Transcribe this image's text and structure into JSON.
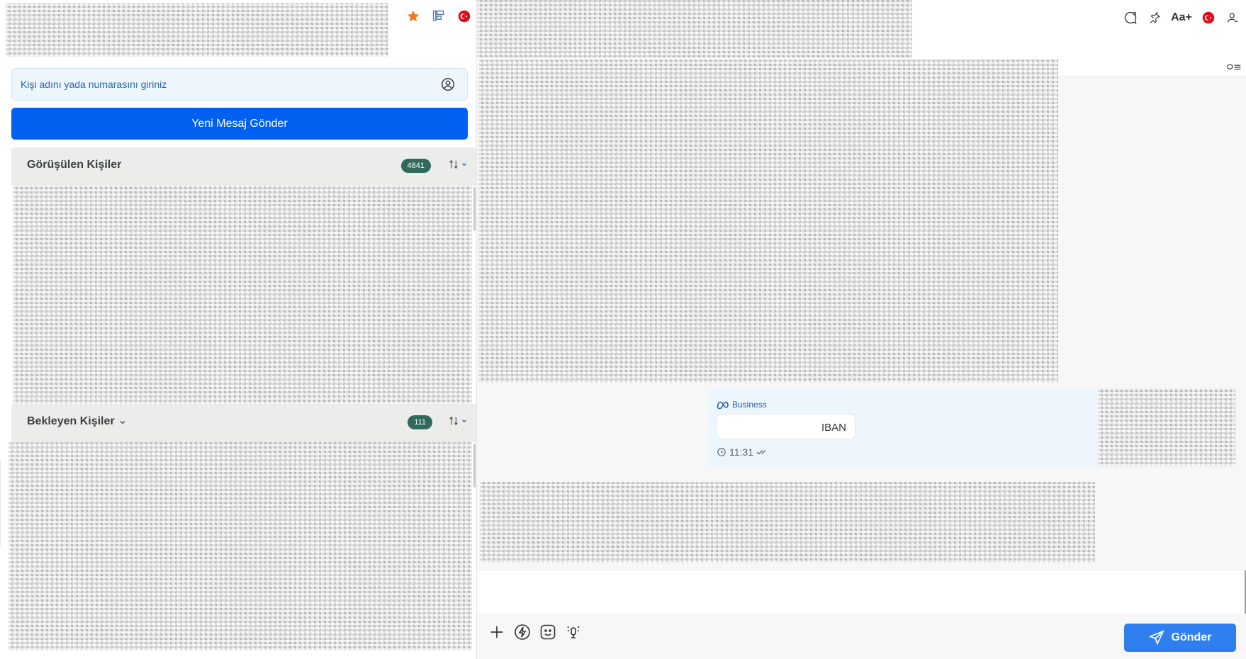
{
  "left_panel": {
    "search": {
      "placeholder": "Kişi adını yada numarasını giriniz"
    },
    "new_message_button": "Yeni Mesaj Gönder",
    "sections": [
      {
        "title": "Görüşülen Kişiler",
        "count": "4841"
      },
      {
        "title": "Bekleyen Kişiler",
        "count": "111"
      }
    ],
    "top_icons": [
      "star-icon",
      "pin-list-icon",
      "turkey-flag-icon"
    ]
  },
  "right_panel": {
    "header_icons": [
      "chat-bubble-icon",
      "pin-icon",
      "font-size-icon",
      "turkey-flag-icon",
      "user-icon"
    ],
    "font_size_label": "Aa+",
    "message": {
      "brand": "Business",
      "text": "IBAN",
      "time": "11:31",
      "status": "read"
    },
    "composer": {
      "tools": [
        "plus-icon",
        "quick-reply-icon",
        "emoji-icon",
        "voice-record-icon"
      ],
      "send_label": "Gönder"
    }
  },
  "colors": {
    "primary": "#0060f0",
    "send": "#2f7ff0",
    "badge": "#2f6a5c",
    "star": "#f07a1f",
    "flag": "#e30a17"
  }
}
